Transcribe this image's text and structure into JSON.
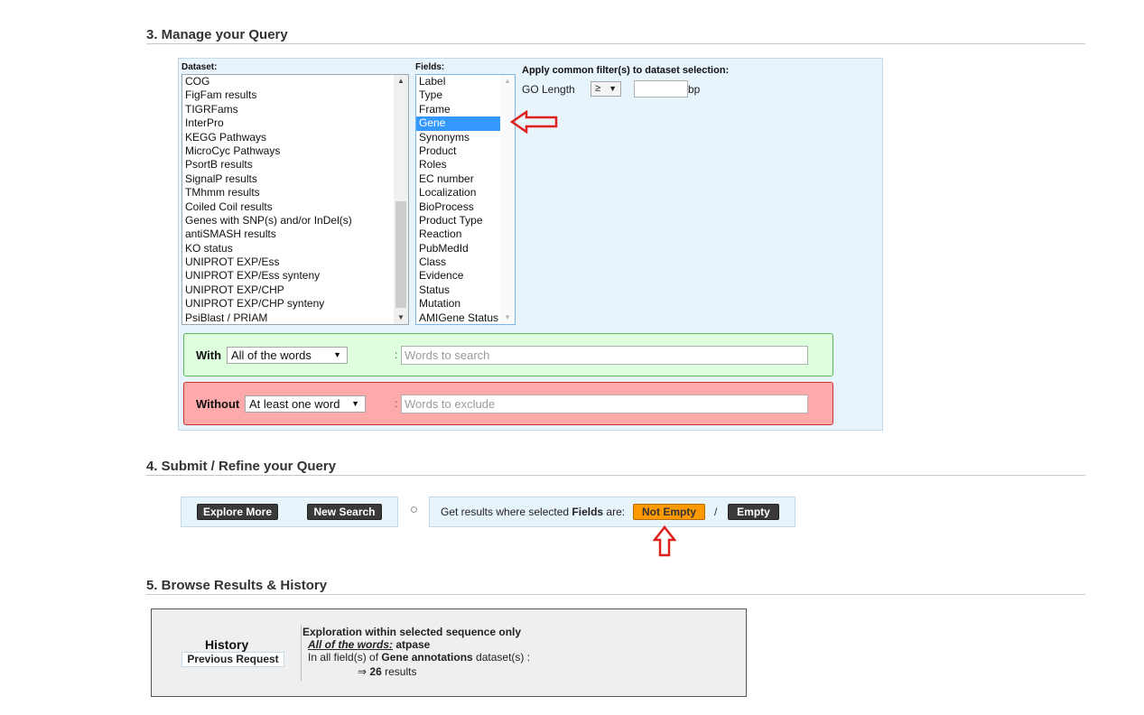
{
  "section3": {
    "title": "3. Manage your Query"
  },
  "dataset": {
    "label": "Dataset:",
    "items": [
      "COG",
      "FigFam results",
      "TIGRFams",
      "InterPro",
      "KEGG Pathways",
      "MicroCyc Pathways",
      "PsortB results",
      "SignalP results",
      "TMhmm results",
      "Coiled Coil results",
      "Genes with SNP(s) and/or InDel(s)",
      "antiSMASH results",
      "KO status",
      "UNIPROT EXP/Ess",
      "UNIPROT EXP/Ess synteny",
      "UNIPROT EXP/CHP",
      "UNIPROT EXP/CHP synteny",
      "PsiBlast / PRIAM"
    ]
  },
  "fields": {
    "label": "Fields:",
    "items": [
      "Label",
      "Type",
      "Frame",
      "Gene",
      "Synonyms",
      "Product",
      "Roles",
      "EC number",
      "Localization",
      "BioProcess",
      "Product Type",
      "Reaction",
      "PubMedId",
      "Class",
      "Evidence",
      "Status",
      "Mutation",
      "AMIGene Status"
    ],
    "selected": "Gene"
  },
  "filter": {
    "title": "Apply common filter(s) to dataset selection:",
    "go_length_label": "GO Length",
    "operator": "≥",
    "value": "",
    "unit": "bp"
  },
  "with": {
    "label": "With",
    "mode": "All of the words",
    "placeholder": "Words to search"
  },
  "without": {
    "label": "Without",
    "mode": "At least one word",
    "placeholder": "Words to exclude"
  },
  "section4": {
    "title": "4. Submit / Refine your Query",
    "explore_more": "Explore More",
    "new_search": "New Search",
    "fields_text_prefix": "Get results where selected ",
    "fields_text_bold": "Fields",
    "fields_text_suffix": " are:",
    "not_empty": "Not Empty",
    "slash": "/",
    "empty": "Empty"
  },
  "section5": {
    "title": "5. Browse Results & History",
    "history_title": "History",
    "previous_request": "Previous Request",
    "exploration": "Exploration within selected sequence only",
    "words_label": "All of the words:",
    "words_value": " atpase",
    "fields_prefix": "In all field(s) of ",
    "fields_bold": "Gene annotations",
    "fields_suffix": " dataset(s) :",
    "result_arrow": "⇒",
    "result_count": "26",
    "result_suffix": " results"
  },
  "colors": {
    "panel": "#e8f4fc",
    "with_bg": "#ddffdd",
    "without_bg": "#ffaaaa",
    "accent_orange": "#ff9900",
    "annotation_red": "#e0201b",
    "selection": "#3399ff"
  }
}
